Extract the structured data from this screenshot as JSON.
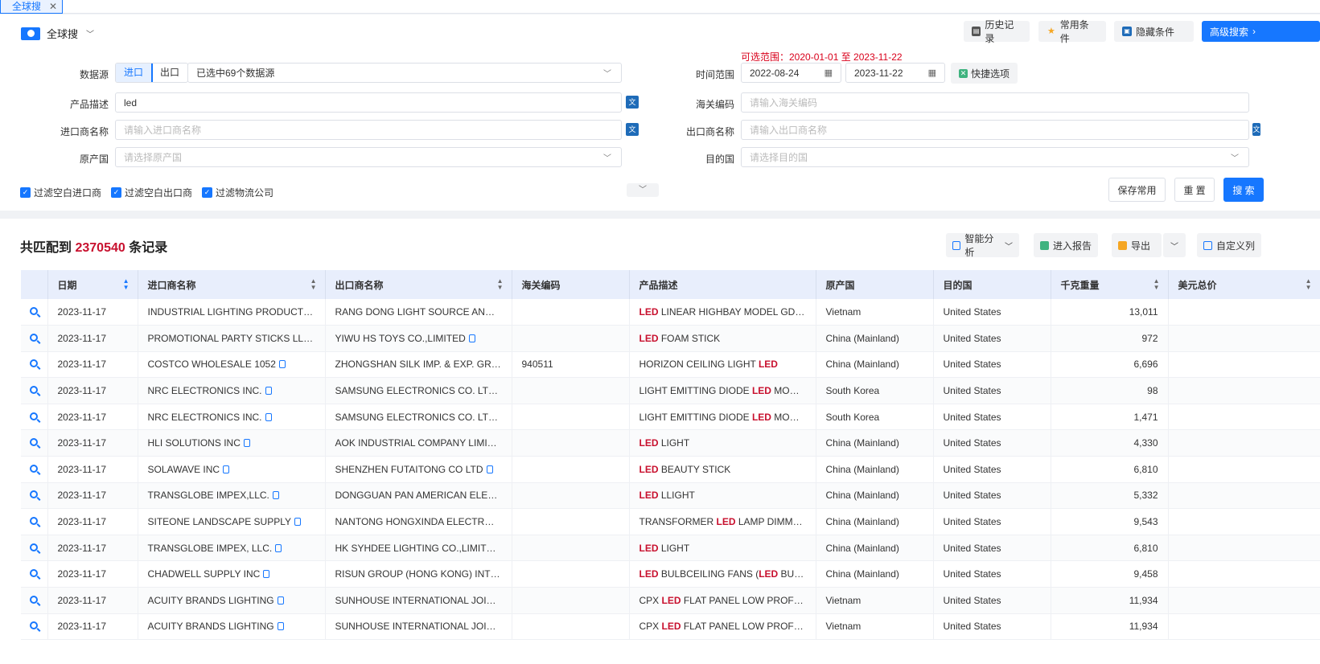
{
  "tab": {
    "label": "全球搜",
    "close": "✕"
  },
  "header": {
    "brand": "全球搜",
    "history": "历史记录",
    "common": "常用条件",
    "hide": "隐藏条件",
    "advanced": "高级搜索"
  },
  "form": {
    "source_label": "数据源",
    "import": "进口",
    "export": "出口",
    "source_value": "已选中69个数据源",
    "product_label": "产品描述",
    "product_value": "led",
    "importer_label": "进口商名称",
    "importer_ph": "请输入进口商名称",
    "origin_label": "原产国",
    "origin_ph": "请选择原产国",
    "time_label": "时间范围",
    "range_hint": "可选范围：2020-01-01 至 2023-11-22",
    "date_from": "2022-08-24",
    "date_to": "2023-11-22",
    "quick": "快捷选项",
    "hs_label": "海关编码",
    "hs_ph": "请输入海关编码",
    "exporter_label": "出口商名称",
    "exporter_ph": "请输入出口商名称",
    "dest_label": "目的国",
    "dest_ph": "请选择目的国",
    "filter1": "过滤空白进口商",
    "filter2": "过滤空白出口商",
    "filter3": "过滤物流公司",
    "save": "保存常用",
    "reset": "重 置",
    "search": "搜 索"
  },
  "results": {
    "prefix": "共匹配到",
    "count": "2370540",
    "suffix": "条记录",
    "analysis": "智能分析",
    "report": "进入报告",
    "export": "导出",
    "custom": "自定义列"
  },
  "columns": [
    "日期",
    "进口商名称",
    "出口商名称",
    "海关编码",
    "产品描述",
    "原产国",
    "目的国",
    "千克重量",
    "美元总价"
  ],
  "rows": [
    {
      "date": "2023-11-17",
      "importer": "INDUSTRIAL LIGHTING PRODUCTS...",
      "exporter": "RANG DONG LIGHT SOURCE AND ...",
      "hs": "",
      "pre": "",
      "hl": "LED",
      "post": " LINEAR HIGHBAY MODEL GDXL10...",
      "hl2": "",
      "post2": "",
      "origin": "Vietnam",
      "dest": "United States",
      "kg": "13,011"
    },
    {
      "date": "2023-11-17",
      "importer": "PROMOTIONAL PARTY STICKS LLC.",
      "exporter": "YIWU HS TOYS CO.,LIMITED",
      "hs": "",
      "pre": "",
      "hl": "LED",
      "post": " FOAM STICK",
      "hl2": "",
      "post2": "",
      "origin": "China (Mainland)",
      "dest": "United States",
      "kg": "972"
    },
    {
      "date": "2023-11-17",
      "importer": "COSTCO WHOLESALE 1052",
      "exporter": "ZHONGSHAN SILK IMP. & EXP. GRO...",
      "hs": "940511",
      "pre": "HORIZON CEILING LIGHT ",
      "hl": "LED",
      "post": "",
      "hl2": "",
      "post2": "",
      "origin": "China (Mainland)",
      "dest": "United States",
      "kg": "6,696"
    },
    {
      "date": "2023-11-17",
      "importer": "NRC ELECTRONICS INC.",
      "exporter": "SAMSUNG ELECTRONICS CO. LTD",
      "hs": "",
      "pre": "LIGHT EMITTING DIODE ",
      "hl": "LED",
      "post": " MODULES",
      "hl2": "",
      "post2": "",
      "origin": "South Korea",
      "dest": "United States",
      "kg": "98"
    },
    {
      "date": "2023-11-17",
      "importer": "NRC ELECTRONICS INC.",
      "exporter": "SAMSUNG ELECTRONICS CO. LTD",
      "hs": "",
      "pre": "LIGHT EMITTING DIODE ",
      "hl": "LED",
      "post": " MODULES",
      "hl2": "",
      "post2": "",
      "origin": "South Korea",
      "dest": "United States",
      "kg": "1,471"
    },
    {
      "date": "2023-11-17",
      "importer": "HLI SOLUTIONS INC",
      "exporter": "AOK INDUSTRIAL COMPANY LIMIT...",
      "hs": "",
      "pre": "",
      "hl": "LED",
      "post": " LIGHT",
      "hl2": "",
      "post2": "",
      "origin": "China (Mainland)",
      "dest": "United States",
      "kg": "4,330"
    },
    {
      "date": "2023-11-17",
      "importer": "SOLAWAVE INC",
      "exporter": "SHENZHEN FUTAITONG CO LTD",
      "hs": "",
      "pre": "",
      "hl": "LED",
      "post": " BEAUTY STICK",
      "hl2": "",
      "post2": "",
      "origin": "China (Mainland)",
      "dest": "United States",
      "kg": "6,810"
    },
    {
      "date": "2023-11-17",
      "importer": "TRANSGLOBE IMPEX,LLC.",
      "exporter": "DONGGUAN PAN AMERICAN ELECT...",
      "hs": "",
      "pre": "",
      "hl": "LED",
      "post": " LLIGHT",
      "hl2": "",
      "post2": "",
      "origin": "China (Mainland)",
      "dest": "United States",
      "kg": "5,332"
    },
    {
      "date": "2023-11-17",
      "importer": "SITEONE LANDSCAPE SUPPLY",
      "exporter": "NANTONG HONGXINDA ELECTRON...",
      "hs": "",
      "pre": "TRANSFORMER ",
      "hl": "LED",
      "post": " LAMP DIMMER",
      "hl2": "",
      "post2": "",
      "origin": "China (Mainland)",
      "dest": "United States",
      "kg": "9,543"
    },
    {
      "date": "2023-11-17",
      "importer": "TRANSGLOBE IMPEX, LLC.",
      "exporter": "HK SYHDEE LIGHTING CO.,LIMITED",
      "hs": "",
      "pre": "",
      "hl": "LED",
      "post": " LIGHT",
      "hl2": "",
      "post2": "",
      "origin": "China (Mainland)",
      "dest": "United States",
      "kg": "6,810"
    },
    {
      "date": "2023-11-17",
      "importer": "CHADWELL SUPPLY INC",
      "exporter": "RISUN GROUP (HONG KONG) INTE...",
      "hs": "",
      "pre": "",
      "hl": "LED",
      "post": " BULBCEILING FANS (",
      "hl2": "LED",
      "post2": " BULB , ...",
      "origin": "China (Mainland)",
      "dest": "United States",
      "kg": "9,458"
    },
    {
      "date": "2023-11-17",
      "importer": "ACUITY BRANDS LIGHTING",
      "exporter": "SUNHOUSE INTERNATIONAL JOIN...",
      "hs": "",
      "pre": "CPX ",
      "hl": "LED",
      "post": " FLAT PANEL LOW PROFILE M...",
      "hl2": "",
      "post2": "",
      "origin": "Vietnam",
      "dest": "United States",
      "kg": "11,934"
    },
    {
      "date": "2023-11-17",
      "importer": "ACUITY BRANDS LIGHTING",
      "exporter": "SUNHOUSE INTERNATIONAL JOIN...",
      "hs": "",
      "pre": "CPX ",
      "hl": "LED",
      "post": " FLAT PANEL LOW PROFILE M...",
      "hl2": "",
      "post2": "",
      "origin": "Vietnam",
      "dest": "United States",
      "kg": "11,934"
    }
  ]
}
